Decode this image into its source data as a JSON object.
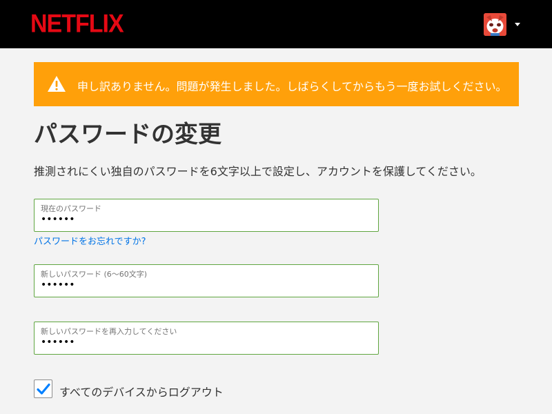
{
  "header": {
    "logo_text": "NETFLIX",
    "avatar": "profile-avatar-red-panda",
    "menu_icon": "caret-down-icon"
  },
  "colors": {
    "brand_red": "#e50914",
    "alert_orange": "#ffa00a",
    "link_blue": "#0073e6",
    "field_border_green": "#5fa53f",
    "checkbox_blue": "#0080ff"
  },
  "alert": {
    "icon": "warning-icon",
    "message": "申し訳ありません。問題が発生しました。しばらくしてからもう一度お試しください。"
  },
  "page": {
    "title": "パスワードの変更",
    "description": "推測されにくい独自のパスワードを6文字以上で設定し、アカウントを保護してください。"
  },
  "form": {
    "current_password": {
      "label": "現在のパスワード",
      "value": "••••••"
    },
    "forgot_link": "パスワードをお忘れですか?",
    "new_password": {
      "label": "新しいパスワード (6〜60文字)",
      "value": "••••••"
    },
    "confirm_password": {
      "label": "新しいパスワードを再入力してください",
      "value": "••••••"
    },
    "logout_all": {
      "label": "すべてのデバイスからログアウト",
      "checked": true
    }
  }
}
